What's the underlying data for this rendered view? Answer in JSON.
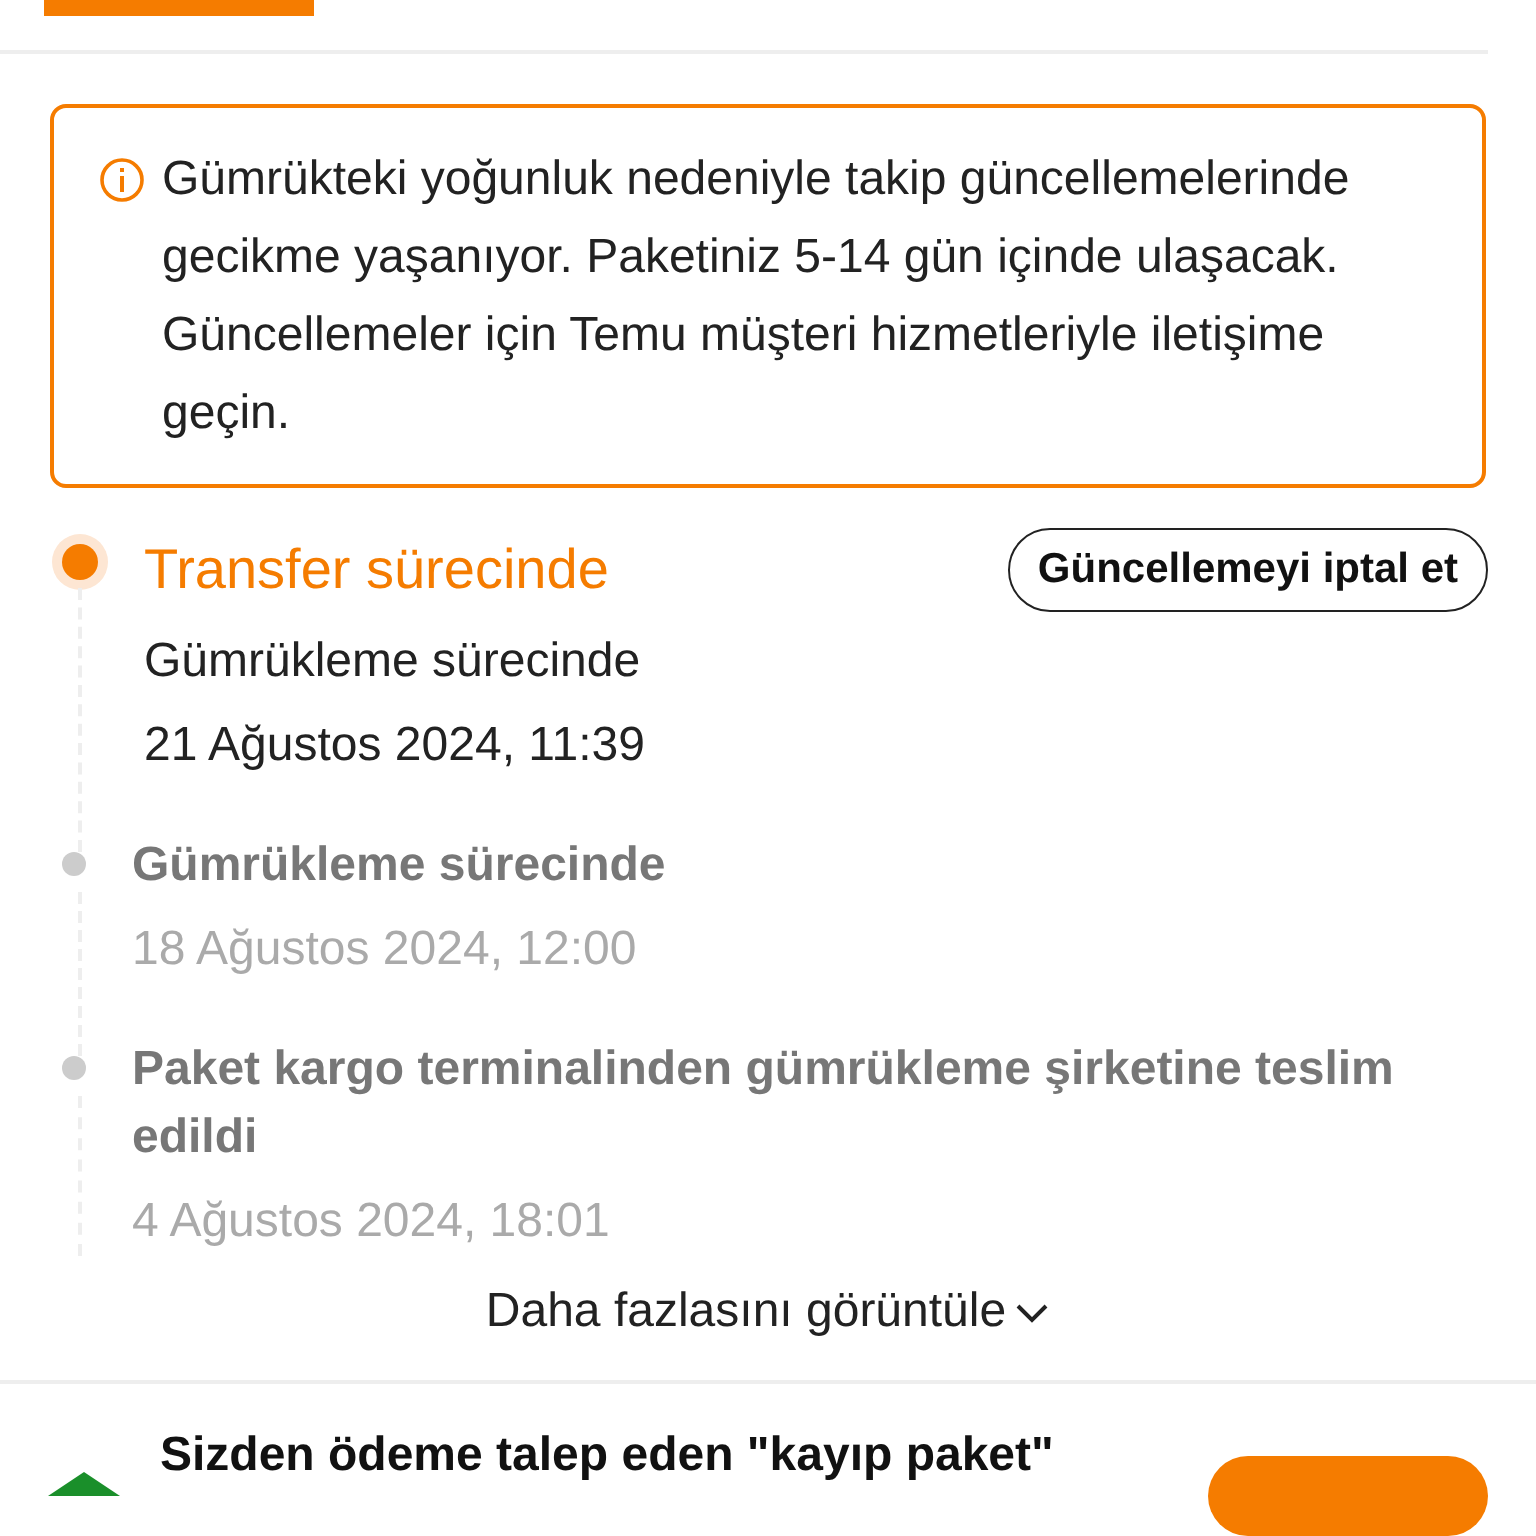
{
  "notice": {
    "text": "Gümrükteki yoğunluk nedeniyle takip güncellemelerinde gecikme yaşanıyor. Paketiniz 5-14 gün içinde ulaşacak. Güncellemeler için Temu müşteri hizmetleriyle iletişime geçin."
  },
  "timeline": [
    {
      "title": "Transfer sürecinde",
      "detail": "Gümrükleme sürecinde",
      "date": "21 Ağustos 2024, 11:39",
      "current": true,
      "action": "Güncellemeyi iptal et"
    },
    {
      "title": "Gümrükleme sürecinde",
      "date": "18 Ağustos 2024, 12:00",
      "current": false
    },
    {
      "title": "Paket kargo terminalinden gümrükleme şirketine teslim edildi",
      "date": "4 Ağustos 2024, 18:01",
      "current": false
    }
  ],
  "more": {
    "label": "Daha fazlasını görüntüle"
  },
  "promo": {
    "text": "Sizden ödeme talep eden \"kayıp paket\""
  }
}
